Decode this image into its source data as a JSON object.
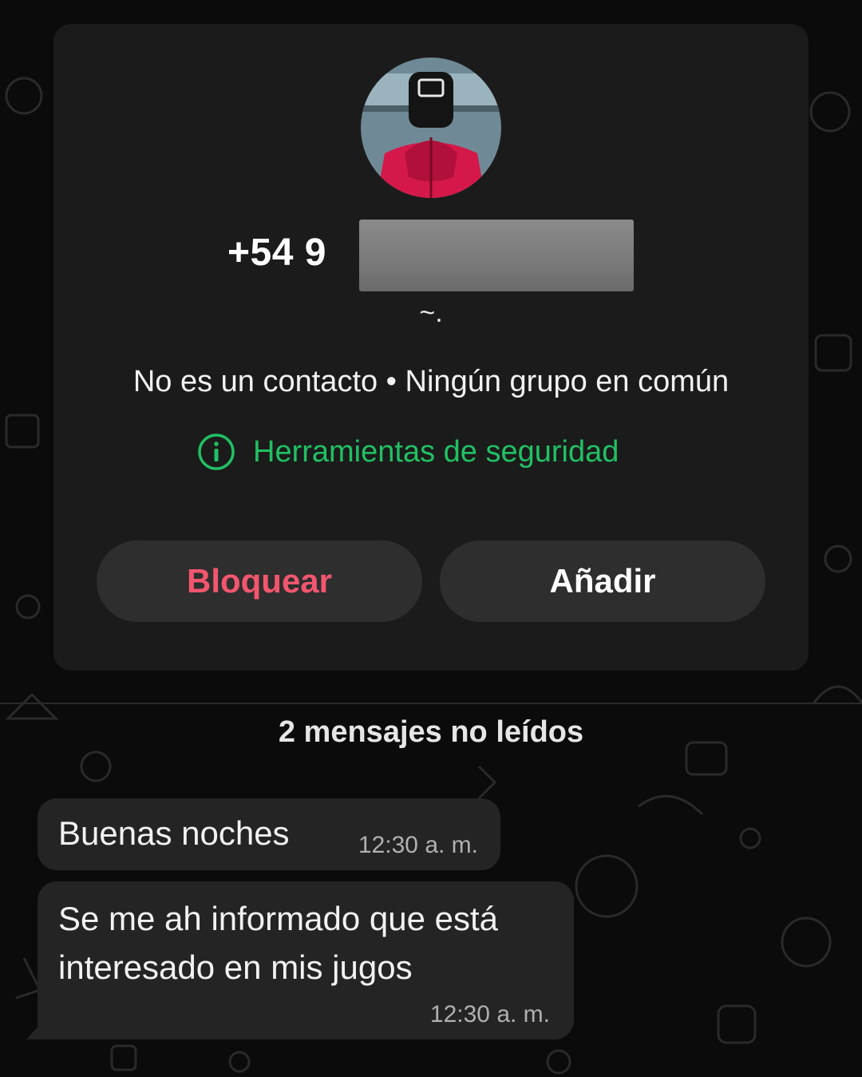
{
  "contact_card": {
    "phone_prefix": "+54 9",
    "push_name": "~.",
    "subtitle": "No es un contacto • Ningún grupo en común",
    "security_link": {
      "label": "Herramientas de seguridad",
      "icon": "info-icon"
    },
    "actions": {
      "block_label": "Bloquear",
      "add_label": "Añadir"
    },
    "colors": {
      "block": "#f2566e",
      "security": "#21c063",
      "card": "#1b1b1b"
    }
  },
  "chat": {
    "unread_banner": "2 mensajes no leídos",
    "messages": [
      {
        "text": "Buenas noches",
        "time": "12:30 a. m."
      },
      {
        "text": "Se me ah informado que está interesado en mis jugos",
        "time": "12:30 a. m."
      }
    ]
  }
}
